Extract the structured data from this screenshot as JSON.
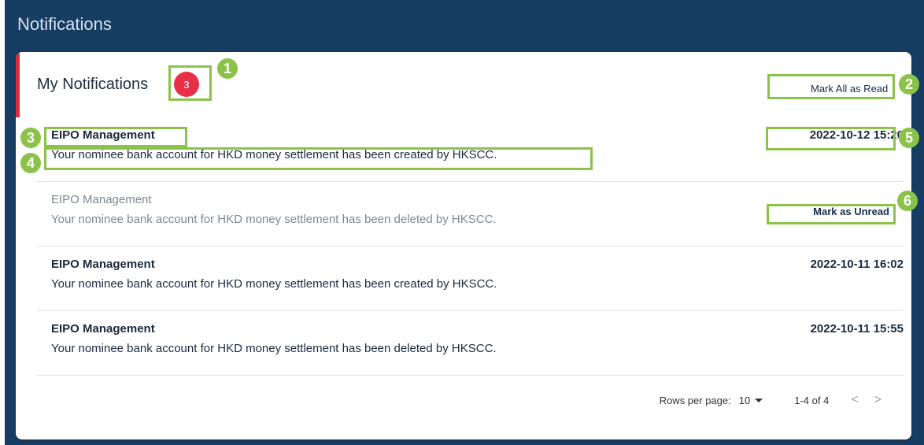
{
  "page": {
    "title": "Notifications"
  },
  "card": {
    "title": "My Notifications",
    "unread_count": "3",
    "mark_all_label": "Mark All as Read"
  },
  "notifications": [
    {
      "source": "EIPO Management",
      "message": "Your nominee bank account for HKD money settlement has been created by HKSCC.",
      "time": "2022-10-12 15:20",
      "read": false
    },
    {
      "source": "EIPO Management",
      "message": "Your nominee bank account for HKD money settlement has been deleted by HKSCC.",
      "action_label": "Mark as Unread",
      "read": true
    },
    {
      "source": "EIPO Management",
      "message": "Your nominee bank account for HKD money settlement has been created by HKSCC.",
      "time": "2022-10-11 16:02",
      "read": false
    },
    {
      "source": "EIPO Management",
      "message": "Your nominee bank account for HKD money settlement has been deleted by HKSCC.",
      "time": "2022-10-11 15:55",
      "read": false
    }
  ],
  "pagination": {
    "rows_label": "Rows per page:",
    "rows_value": "10",
    "range": "1-4 of 4",
    "prev": "<",
    "next": ">"
  },
  "annotations": [
    "1",
    "2",
    "3",
    "4",
    "5",
    "6"
  ],
  "colors": {
    "accent": "#e2293f",
    "badge": "#ea2e45",
    "header": "#173d63",
    "annotation": "#8bc34a"
  }
}
